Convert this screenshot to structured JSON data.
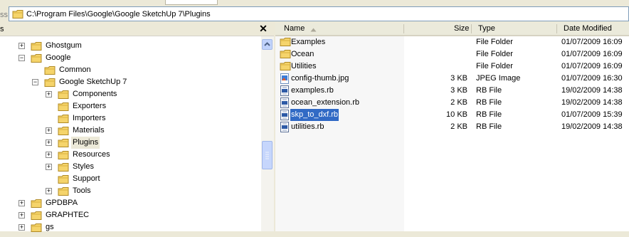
{
  "address": {
    "label_fragment": "ss",
    "path": "C:\\Program Files\\Google\\Google SketchUp 7\\Plugins"
  },
  "folders_pane": {
    "title_fragment": "s",
    "close_glyph": "✕",
    "tree": [
      {
        "label": "Ghostgum",
        "expander": "+",
        "level": 0
      },
      {
        "label": "Google",
        "expander": "−",
        "level": 0
      },
      {
        "label": "Common",
        "expander": "",
        "level": 1
      },
      {
        "label": "Google SketchUp 7",
        "expander": "−",
        "level": 1
      },
      {
        "label": "Components",
        "expander": "+",
        "level": 2
      },
      {
        "label": "Exporters",
        "expander": "",
        "level": 2
      },
      {
        "label": "Importers",
        "expander": "",
        "level": 2
      },
      {
        "label": "Materials",
        "expander": "+",
        "level": 2
      },
      {
        "label": "Plugins",
        "expander": "+",
        "level": 2,
        "selected": true
      },
      {
        "label": "Resources",
        "expander": "+",
        "level": 2
      },
      {
        "label": "Styles",
        "expander": "+",
        "level": 2
      },
      {
        "label": "Support",
        "expander": "",
        "level": 2
      },
      {
        "label": "Tools",
        "expander": "+",
        "level": 2
      },
      {
        "label": "GPDBPA",
        "expander": "+",
        "level": 0
      },
      {
        "label": "GRAPHTEC",
        "expander": "+",
        "level": 0
      },
      {
        "label": "gs",
        "expander": "+",
        "level": 0
      }
    ]
  },
  "file_list": {
    "columns": {
      "name": "Name",
      "size": "Size",
      "type": "Type",
      "date": "Date Modified"
    },
    "rows": [
      {
        "name": "Examples",
        "size": "",
        "type": "File Folder",
        "date": "01/07/2009 16:09",
        "icon": "folder-icon"
      },
      {
        "name": "Ocean",
        "size": "",
        "type": "File Folder",
        "date": "01/07/2009 16:09",
        "icon": "folder-icon"
      },
      {
        "name": "Utilities",
        "size": "",
        "type": "File Folder",
        "date": "01/07/2009 16:09",
        "icon": "folder-icon"
      },
      {
        "name": "config-thumb.jpg",
        "size": "3 KB",
        "type": "JPEG Image",
        "date": "01/07/2009 16:30",
        "icon": "image-file-icon"
      },
      {
        "name": "examples.rb",
        "size": "3 KB",
        "type": "RB File",
        "date": "19/02/2009 14:38",
        "icon": "rb-file-icon"
      },
      {
        "name": "ocean_extension.rb",
        "size": "2 KB",
        "type": "RB File",
        "date": "19/02/2009 14:38",
        "icon": "rb-file-icon"
      },
      {
        "name": "skp_to_dxf.rb",
        "size": "10 KB",
        "type": "RB File",
        "date": "01/07/2009 15:39",
        "icon": "rb-file-icon",
        "selected": true
      },
      {
        "name": "utilities.rb",
        "size": "2 KB",
        "type": "RB File",
        "date": "19/02/2009 14:38",
        "icon": "rb-file-icon"
      }
    ]
  },
  "colors": {
    "selection": "#316ac5",
    "folder": "#f5d46b",
    "chrome": "#ece9d8"
  }
}
